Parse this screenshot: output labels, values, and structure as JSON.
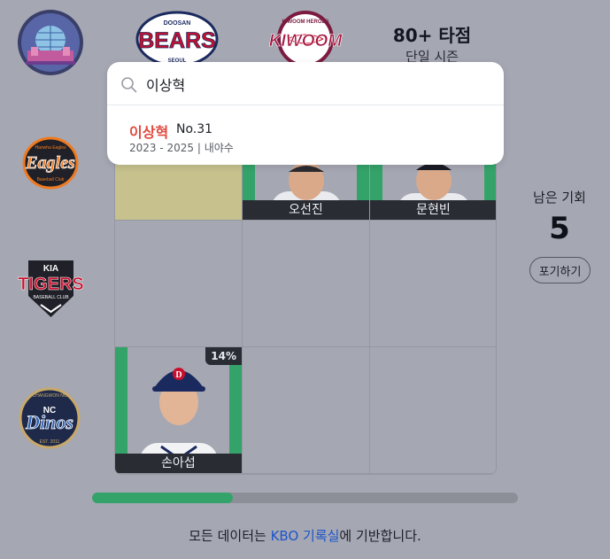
{
  "header": {
    "criteria_title": "80+ 타점",
    "criteria_sub": "단일 시즌",
    "col_logos": [
      {
        "icon": "doosan-bears-logo",
        "text_top": "DOOSAN",
        "text_main": "BEARS",
        "text_bottom": "SEOUL"
      },
      {
        "icon": "kiwoom-heroes-logo",
        "text_main": "KIWOOM",
        "text_ring": "KIWOOM HEROES"
      }
    ],
    "corner_icon": "dome-stadium-icon"
  },
  "rows": [
    {
      "icon": "hanwha-eagles-logo",
      "text_main": "Eagles",
      "text_ring": "Hanwha Eagles Baseball Club"
    },
    {
      "icon": "kia-tigers-logo",
      "text_top": "KIA",
      "text_main": "TIGERS",
      "text_bottom": "BASEBALL CLUB"
    },
    {
      "icon": "nc-dinos-logo",
      "text_top": "NC",
      "text_main": "Dinos",
      "text_ring": "CHANGWON NC",
      "text_bottom": "EST. 2011"
    }
  ],
  "grid": {
    "cells": [
      {
        "row": 0,
        "col": 0,
        "state": "yellow"
      },
      {
        "row": 0,
        "col": 1,
        "state": "filled",
        "name": "오선진"
      },
      {
        "row": 0,
        "col": 2,
        "state": "filled",
        "name": "문현빈"
      },
      {
        "row": 1,
        "col": 0,
        "state": "empty"
      },
      {
        "row": 1,
        "col": 1,
        "state": "empty"
      },
      {
        "row": 1,
        "col": 2,
        "state": "empty"
      },
      {
        "row": 2,
        "col": 0,
        "state": "filled",
        "name": "손아섭",
        "pct": "14%"
      },
      {
        "row": 2,
        "col": 1,
        "state": "empty"
      },
      {
        "row": 2,
        "col": 2,
        "state": "empty"
      }
    ]
  },
  "side": {
    "remaining_label": "남은 기회",
    "remaining_count": "5",
    "give_up_label": "포기하기"
  },
  "progress": {
    "fraction": 0.33
  },
  "footer": {
    "prefix": "모든 데이터는 ",
    "link": "KBO 기록실",
    "suffix": "에 기반합니다."
  },
  "search": {
    "value": "이상혁",
    "results": [
      {
        "name": "이상혁",
        "number": "No.31",
        "meta": "2023 - 2025 | 내야수"
      }
    ]
  },
  "colors": {
    "accent_green": "#34a36a",
    "highlight_red": "#e04a3f",
    "link_blue": "#1d55c9"
  }
}
